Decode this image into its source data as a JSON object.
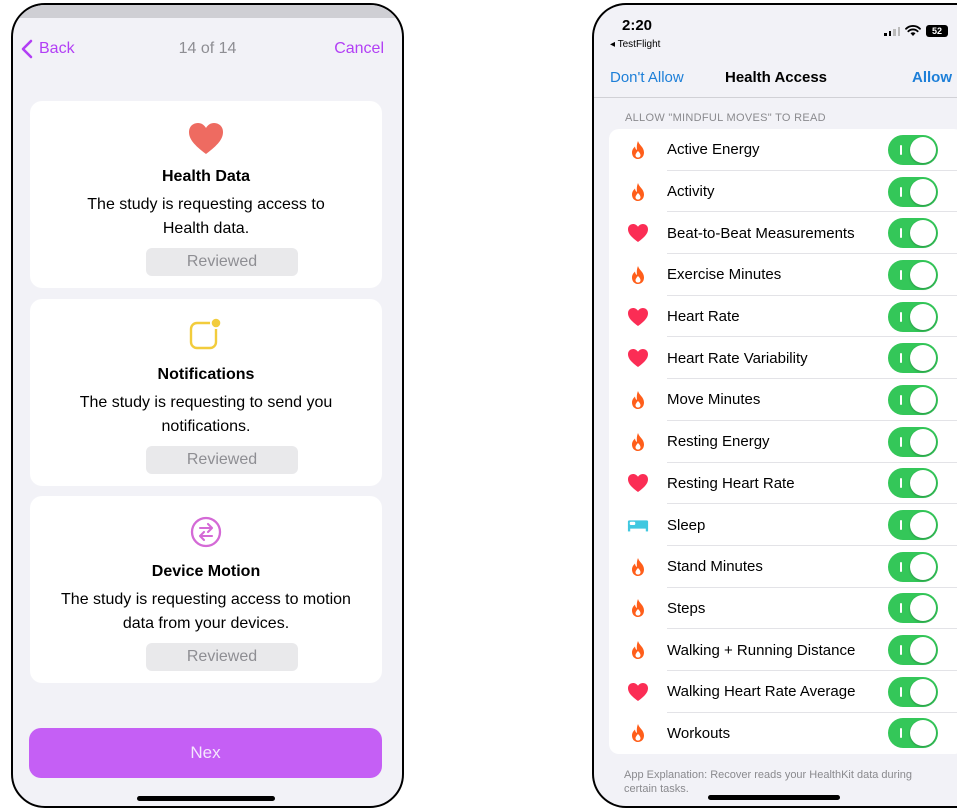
{
  "left": {
    "nav": {
      "back_label": "Back",
      "progress": "14 of 14",
      "cancel_label": "Cancel"
    },
    "cards": [
      {
        "icon": "heart-icon",
        "title": "Health Data",
        "desc_line1": "The study is requesting access to",
        "desc_line2": "Health data.",
        "button": "Reviewed"
      },
      {
        "icon": "notification-badge-icon",
        "title": "Notifications",
        "desc_line1": "The study is requesting to send you",
        "desc_line2": "notifications.",
        "button": "Reviewed"
      },
      {
        "icon": "motion-arrows-icon",
        "title": "Device Motion",
        "desc_line1": "The study is requesting access to motion",
        "desc_line2": "data from your devices.",
        "button": "Reviewed"
      }
    ],
    "next_label": "Nex",
    "colors": {
      "accent": "#b23ff5",
      "button": "#c55ff5"
    }
  },
  "right": {
    "status": {
      "time": "2:20",
      "back_app": "◂ TestFlight",
      "battery": "52"
    },
    "nav": {
      "dont_allow": "Don't Allow",
      "title": "Health Access",
      "allow": "Allow"
    },
    "section_header": "ALLOW \"MINDFUL MOVES\" TO READ",
    "items": [
      {
        "label": "Active Energy",
        "icon": "flame-icon",
        "on": true
      },
      {
        "label": "Activity",
        "icon": "flame-icon",
        "on": true
      },
      {
        "label": "Beat-to-Beat Measurements",
        "icon": "heart-icon",
        "on": true
      },
      {
        "label": "Exercise Minutes",
        "icon": "flame-icon",
        "on": true
      },
      {
        "label": "Heart Rate",
        "icon": "heart-icon",
        "on": true
      },
      {
        "label": "Heart Rate Variability",
        "icon": "heart-icon",
        "on": true
      },
      {
        "label": "Move Minutes",
        "icon": "flame-icon",
        "on": true
      },
      {
        "label": "Resting Energy",
        "icon": "flame-icon",
        "on": true
      },
      {
        "label": "Resting Heart Rate",
        "icon": "heart-icon",
        "on": true
      },
      {
        "label": "Sleep",
        "icon": "bed-icon",
        "on": true
      },
      {
        "label": "Stand Minutes",
        "icon": "flame-icon",
        "on": true
      },
      {
        "label": "Steps",
        "icon": "flame-icon",
        "on": true
      },
      {
        "label": "Walking + Running Distance",
        "icon": "flame-icon",
        "on": true
      },
      {
        "label": "Walking Heart Rate Average",
        "icon": "heart-icon",
        "on": true
      },
      {
        "label": "Workouts",
        "icon": "flame-icon",
        "on": true
      }
    ],
    "explanation": "App Explanation: Recover reads your HealthKit data during certain tasks.",
    "colors": {
      "link": "#1d7fd8",
      "toggle_on": "#34c759",
      "flame": "#ff5e1a",
      "heart": "#fb2d55",
      "bed": "#40c8e0"
    }
  }
}
